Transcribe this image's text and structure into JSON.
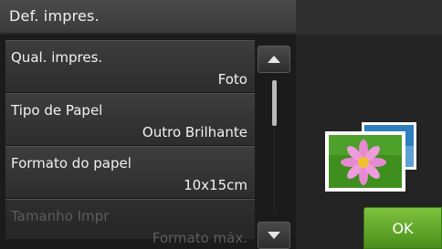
{
  "header": {
    "title": "Def. impres."
  },
  "settings": [
    {
      "label": "Qual. impres.",
      "value": "Foto",
      "enabled": true
    },
    {
      "label": "Tipo de Papel",
      "value": "Outro Brilhante",
      "enabled": true
    },
    {
      "label": "Formato do papel",
      "value": "10x15cm",
      "enabled": true
    },
    {
      "label": "Tamanho Impr",
      "value": "Formato máx.",
      "enabled": false
    }
  ],
  "actions": {
    "ok_label": "OK"
  },
  "icons": {
    "scroll_up": "triangle-up-icon",
    "scroll_down": "triangle-down-icon",
    "preview": "photo-flower-icon"
  },
  "colors": {
    "accent": "#5fa52a",
    "background": "#1b1b1b",
    "text": "#f2f2f2",
    "disabled_text": "#5d5d5d"
  }
}
